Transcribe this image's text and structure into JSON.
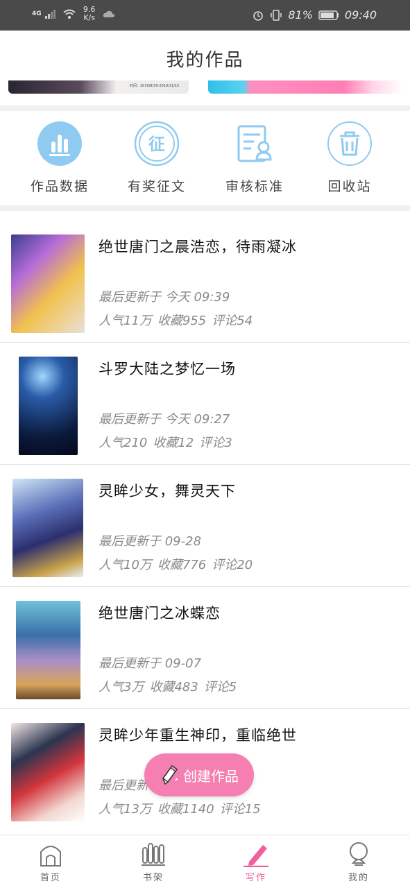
{
  "status_bar": {
    "signal_label": "4G",
    "speed": "9.6 K/s",
    "battery": "81%",
    "time": "09:40"
  },
  "header": {
    "title": "我的作品"
  },
  "banner": {
    "caption": "时间：2019/8/30-2019/11/15"
  },
  "quick_actions": [
    {
      "label": "作品数据",
      "icon": "bar-chart-icon"
    },
    {
      "label": "有奖征文",
      "icon": "contest-badge-icon"
    },
    {
      "label": "审核标准",
      "icon": "review-document-icon"
    },
    {
      "label": "回收站",
      "icon": "trash-icon"
    }
  ],
  "works": [
    {
      "title": "绝世唐门之晨浩恋，待雨凝冰",
      "updated": "最后更新于 今天 09:39",
      "popularity": "人气11万",
      "favorites": "收藏955",
      "comments": "评论54"
    },
    {
      "title": "斗罗大陆之梦忆一场",
      "updated": "最后更新于 今天 09:27",
      "popularity": "人气210",
      "favorites": "收藏12",
      "comments": "评论3"
    },
    {
      "title": "灵眸少女，舞灵天下",
      "updated": "最后更新于 09-28",
      "popularity": "人气10万",
      "favorites": "收藏776",
      "comments": "评论20"
    },
    {
      "title": "绝世唐门之冰蝶恋",
      "updated": "最后更新于 09-07",
      "popularity": "人气3万",
      "favorites": "收藏483",
      "comments": "评论5"
    },
    {
      "title": "灵眸少年重生神印，重临绝世",
      "updated": "最后更新于",
      "popularity": "人气13万",
      "favorites": "收藏1140",
      "comments": "评论15"
    }
  ],
  "fab": {
    "label": "创建作品",
    "color": "#f47fb0"
  },
  "tabs": [
    {
      "label": "首页",
      "icon": "home-icon",
      "active": false
    },
    {
      "label": "书架",
      "icon": "bookshelf-icon",
      "active": false
    },
    {
      "label": "写作",
      "icon": "pen-icon",
      "active": true
    },
    {
      "label": "我的",
      "icon": "profile-icon",
      "active": false
    }
  ],
  "colors": {
    "accent": "#f47fb0",
    "icon_blue": "#8fcaf0",
    "active_tab": "#f0609a"
  }
}
